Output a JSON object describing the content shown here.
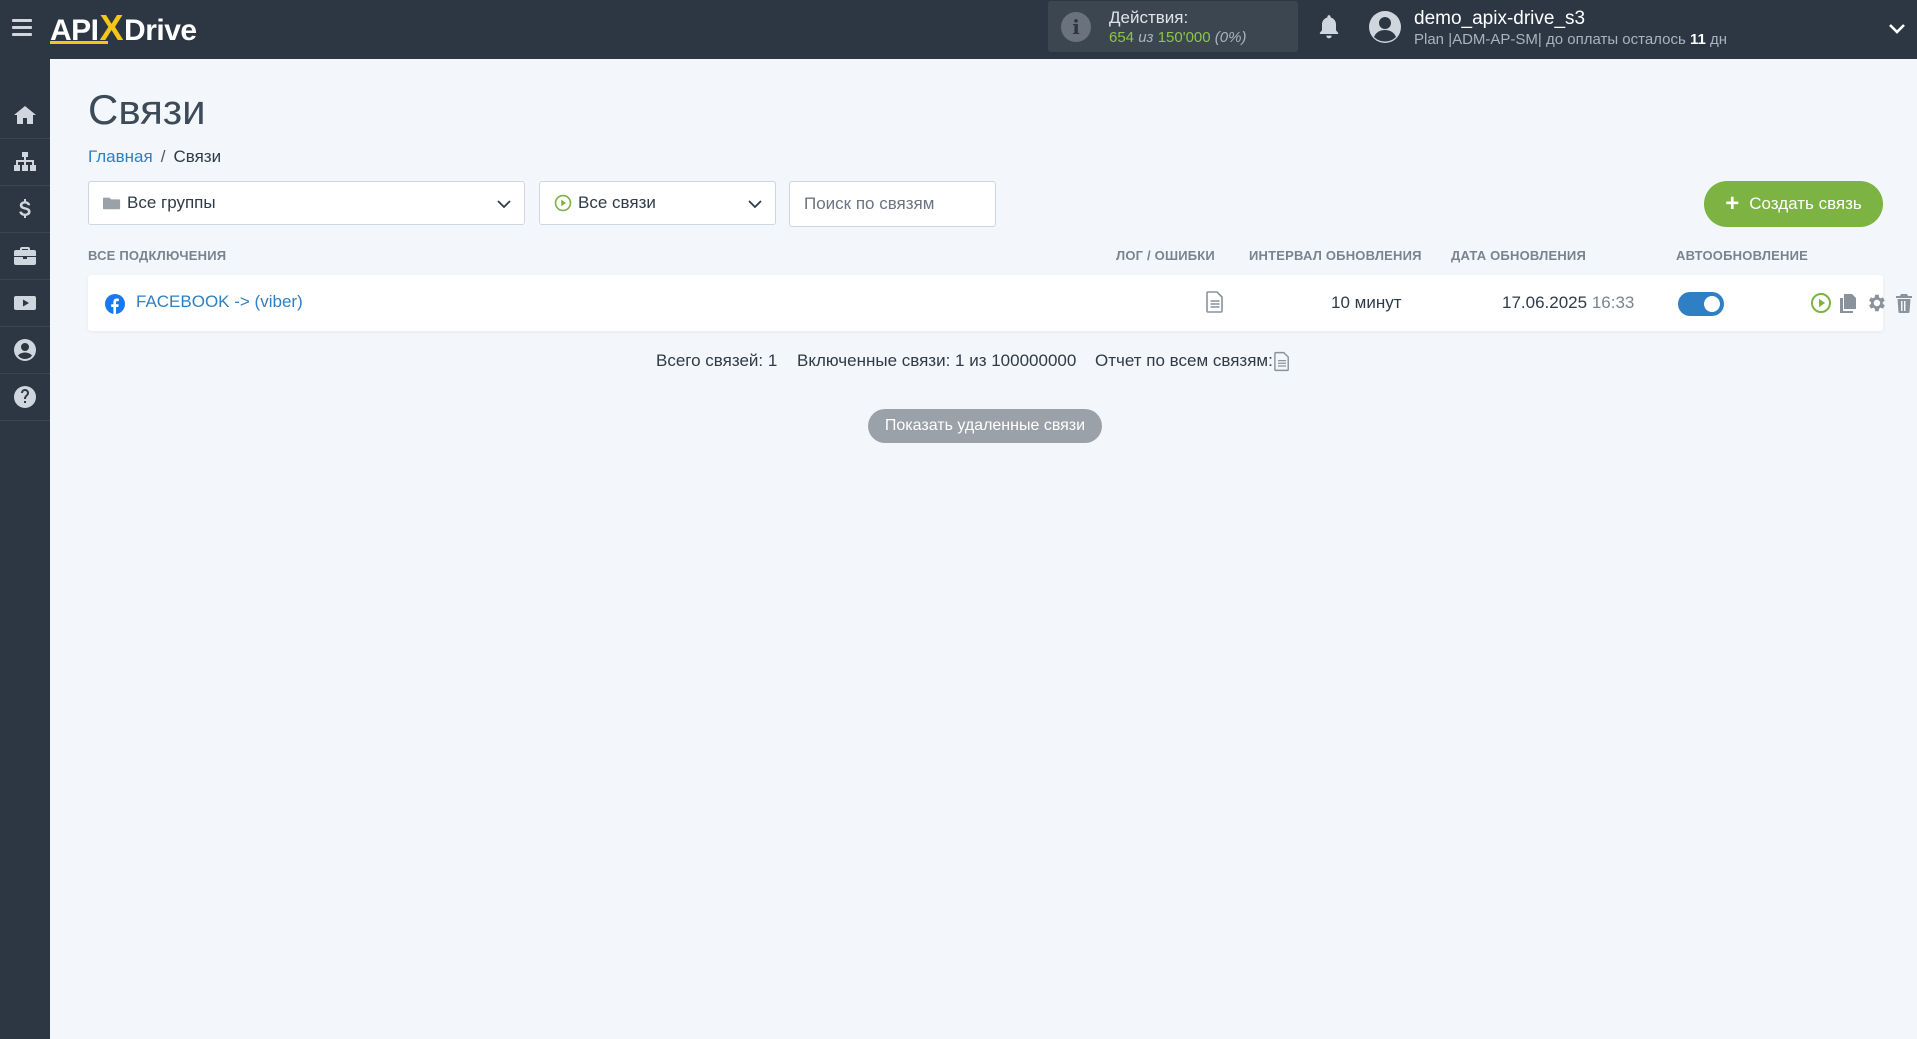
{
  "header": {
    "logo_left": "API",
    "logo_x": "X",
    "logo_right": "Drive",
    "actions_label": "Действия:",
    "actions_used": "654",
    "actions_of": " из ",
    "actions_total": "150'000",
    "actions_percent": "(0%)",
    "user_name": "demo_apix-drive_s3",
    "plan_text": "Plan |ADM-AP-SM| до оплаты осталось ",
    "plan_days": "11",
    "plan_days_unit": " дн"
  },
  "sidebar": {
    "items": [
      "home-icon",
      "sitemap-icon",
      "dollar-icon",
      "briefcase-icon",
      "video-icon",
      "user-circle-icon",
      "help-icon"
    ]
  },
  "page": {
    "title": "Связи",
    "breadcrumb_home": "Главная",
    "breadcrumb_sep": "/",
    "breadcrumb_current": "Связи"
  },
  "filters": {
    "groups_value": "Все группы",
    "status_value": "Все связи",
    "search_placeholder": "Поиск по связям",
    "create_label": "Создать связь"
  },
  "table": {
    "headers": {
      "all": "ВСЕ ПОДКЛЮЧЕНИЯ",
      "log": "ЛОГ / ОШИБКИ",
      "interval": "ИНТЕРВАЛ ОБНОВЛЕНИЯ",
      "date": "ДАТА ОБНОВЛЕНИЯ",
      "auto": "АВТООБНОВЛЕНИЕ"
    },
    "rows": [
      {
        "name": "FACEBOOK -> (viber)",
        "interval": "10 минут",
        "date": "17.06.2025",
        "time": "16:33",
        "auto_update": true
      }
    ]
  },
  "summary": {
    "total": "Всего связей: 1",
    "enabled": "Включенные связи: 1 из 100000000",
    "report": "Отчет по всем связям:"
  },
  "show_deleted": "Показать удаленные связи",
  "colors": {
    "topbar": "#2d3743",
    "accent_green": "#7cb342",
    "link_blue": "#2f7fc4",
    "toggle_on": "#2f7fc4"
  }
}
